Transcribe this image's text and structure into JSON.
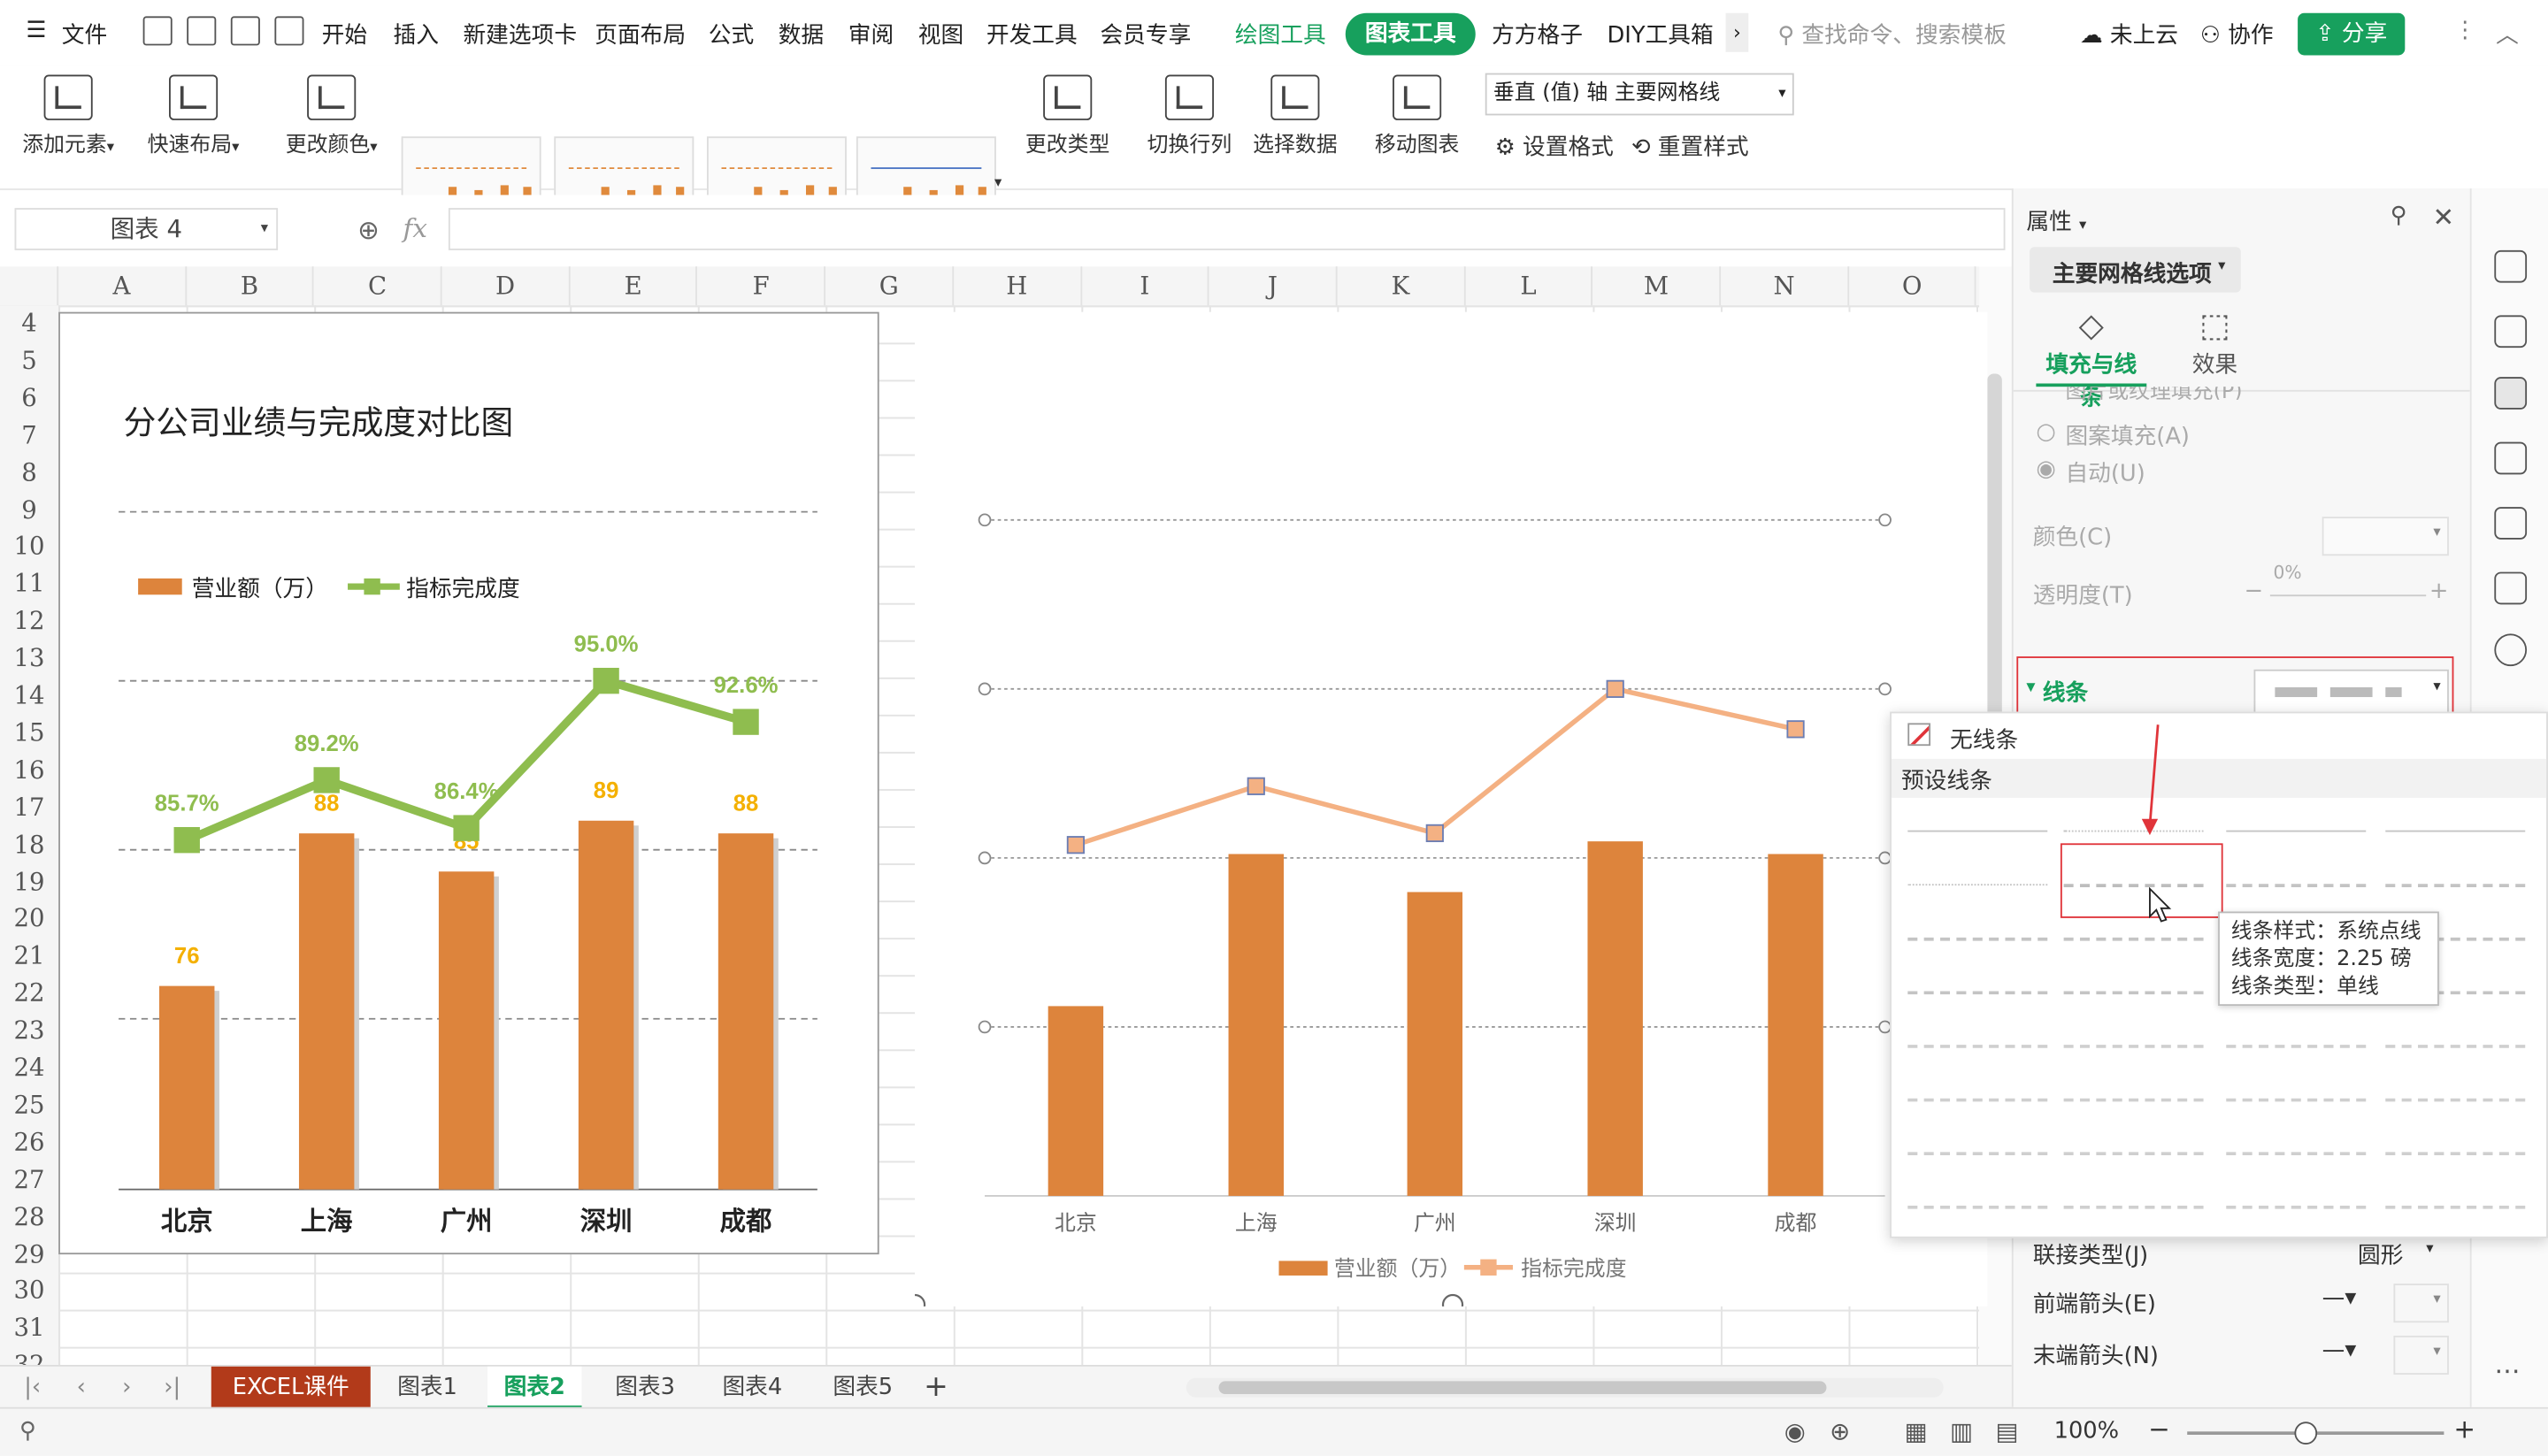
{
  "menubar": {
    "file_label": "文件",
    "menus": [
      "开始",
      "插入",
      "新建选项卡",
      "页面布局",
      "公式",
      "数据",
      "审阅",
      "视图",
      "开发工具",
      "会员专享"
    ],
    "context_tabs": {
      "draw": "绘图工具",
      "chart": "图表工具",
      "ff": "方方格子",
      "diy": "DIY工具箱"
    },
    "search_placeholder": "查找命令、搜索模板",
    "cloud_label": "未上云",
    "collab_label": "协作",
    "share_label": "分享"
  },
  "ribbon": {
    "add_element": "添加元素",
    "quick_layout": "快速布局",
    "change_color": "更改颜色",
    "change_type": "更改类型",
    "switch_rowcol": "切换行列",
    "select_data": "选择数据",
    "move_chart": "移动图表",
    "axis_select": "垂直 (值) 轴 主要网格线",
    "set_format": "设置格式",
    "reset_style": "重置样式"
  },
  "formula_bar": {
    "name_box": "图表 4",
    "fx": "fx"
  },
  "columns": [
    "A",
    "B",
    "C",
    "D",
    "E",
    "F",
    "G",
    "H",
    "I",
    "J",
    "K",
    "L",
    "M",
    "N",
    "O"
  ],
  "rows": [
    "4",
    "5",
    "6",
    "7",
    "8",
    "9",
    "10",
    "11",
    "12",
    "13",
    "14",
    "15",
    "16",
    "17",
    "18",
    "19",
    "20",
    "21",
    "22",
    "23",
    "24",
    "25",
    "26",
    "27",
    "28",
    "29",
    "30",
    "31",
    "32"
  ],
  "chart_data": [
    {
      "type": "bar",
      "title": "分公司业绩与完成度对比图",
      "categories": [
        "北京",
        "上海",
        "广州",
        "深圳",
        "成都"
      ],
      "series": [
        {
          "name": "营业额（万）",
          "type": "bar",
          "values": [
            76,
            88,
            85,
            89,
            88
          ],
          "color": "#dd843c"
        },
        {
          "name": "指标完成度",
          "type": "line",
          "values": [
            85.7,
            89.2,
            86.4,
            95.0,
            92.6
          ],
          "labels": [
            "85.7%",
            "89.2%",
            "86.4%",
            "95.0%",
            "92.6%"
          ],
          "color": "#8fbd4f"
        }
      ],
      "grid": "dashed",
      "legend": "top-left"
    },
    {
      "type": "bar",
      "categories": [
        "北京",
        "上海",
        "广州",
        "深圳",
        "成都"
      ],
      "series": [
        {
          "name": "营业额（万）",
          "type": "bar",
          "values": [
            76,
            88,
            85,
            89,
            88
          ],
          "color": "#dd843c"
        },
        {
          "name": "指标完成度",
          "type": "line",
          "values": [
            85.7,
            89.2,
            86.4,
            95.0,
            92.6
          ],
          "color": "#f4b183"
        }
      ],
      "grid": "dotted",
      "legend": "bottom"
    }
  ],
  "panel": {
    "title": "属性",
    "section": "主要网格线选项",
    "tab_fill_line": "填充与线条",
    "tab_effect": "效果",
    "opt_cut": "图片或纹理填充(P)",
    "opt_pattern": "图案填充(A)",
    "opt_auto": "自动(U)",
    "color_label": "颜色(C)",
    "transparency_label": "透明度(T)",
    "transparency_value": "0%",
    "line_label": "线条",
    "join_type_label": "联接类型(J)",
    "join_type_value": "圆形",
    "start_arrow_label": "前端箭头(E)",
    "end_arrow_label": "末端箭头(N)"
  },
  "dropdown": {
    "no_line": "无线条",
    "preset_lines": "预设线条",
    "tooltip": {
      "style": "线条样式：系统点线",
      "width": "线条宽度：2.25 磅",
      "type": "线条类型：单线"
    }
  },
  "sheets": [
    "EXCEL课件",
    "图表1",
    "图表2",
    "图表3",
    "图表4",
    "图表5"
  ],
  "statusbar": {
    "zoom": "100%"
  }
}
